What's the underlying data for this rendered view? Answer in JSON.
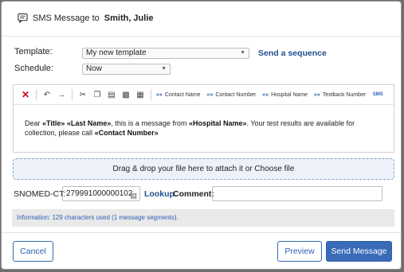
{
  "dialog": {
    "title_prefix": "SMS Message to",
    "recipient": "Smith, Julie",
    "icon": "sms-message-icon"
  },
  "template": {
    "label": "Template:",
    "value": "My new template",
    "send_sequence": "Send a sequence"
  },
  "schedule": {
    "label": "Schedule:",
    "value": "Now"
  },
  "toolbar": {
    "buttons": [
      "remove-format-icon",
      "undo-icon",
      "redo-icon",
      "cut-icon",
      "copy-icon",
      "paste-icon",
      "paste-text-icon",
      "paste-word-icon"
    ],
    "field_quote": "«»",
    "fields": [
      "Contact Name",
      "Contact Number",
      "Hospital Name",
      "Textback Number"
    ],
    "source_label": "SMS"
  },
  "message": {
    "t1": "Dear ",
    "f_title": "«Title»",
    "t2": " ",
    "f_last": "«Last Name»",
    "t3": ", this is a message from ",
    "f_hospital": "«Hospital Name»",
    "t4": ". Your test results are available for collection, please call ",
    "f_contact": "«Contact Number»"
  },
  "dropzone": {
    "text": "Drag & drop your file here to attach it or Choose file"
  },
  "snomed": {
    "label": "SNOMED-CT:",
    "value": "279991000000102",
    "lookup": "Lookup.",
    "comment_label": "Comment:",
    "comment_value": ""
  },
  "info": {
    "text": "Information: 129 characters used (1 message segments)."
  },
  "buttons": {
    "cancel": "Cancel",
    "preview": "Preview",
    "send": "Send Message"
  },
  "colors": {
    "accent": "#3a6bb8",
    "link": "#1f4f8f",
    "error": "#d0021b",
    "info_text": "#2b5fb3"
  }
}
